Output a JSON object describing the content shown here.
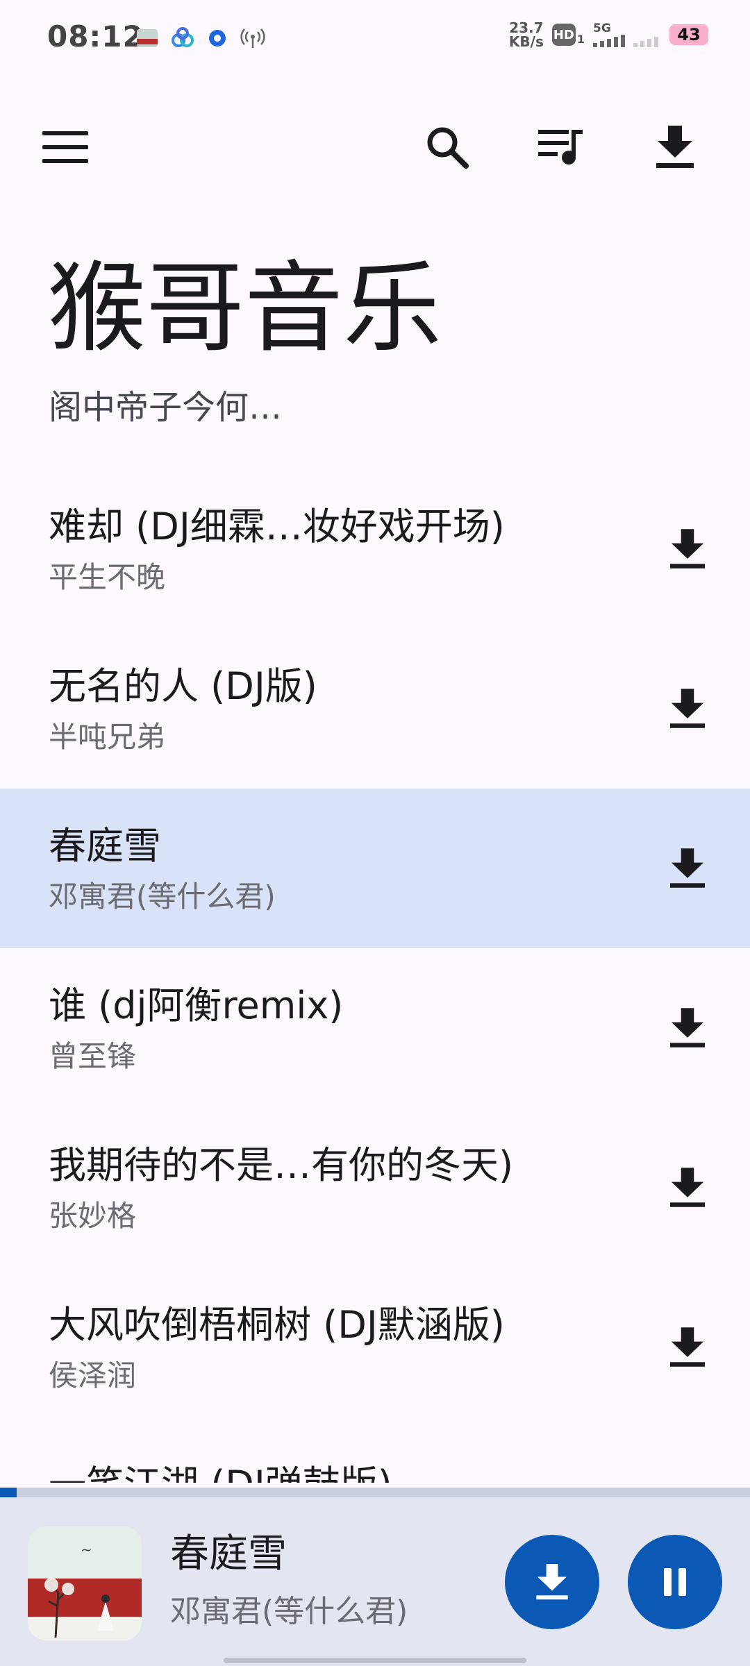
{
  "status_bar": {
    "time": "08:12",
    "net_speed_value": "23.7",
    "net_speed_unit": "KB/s",
    "hd_label": "HD",
    "hd_sub": "1",
    "network_type": "5G",
    "battery": "43"
  },
  "app_bar": {
    "menu_icon": "menu-icon",
    "search_icon": "search-icon",
    "queue_icon": "queue-music-icon",
    "download_icon": "download-icon"
  },
  "header": {
    "title": "猴哥音乐",
    "subtitle": "阁中帝子今何…"
  },
  "songs": [
    {
      "title": "难却 (DJ细霖…妆好戏开场)",
      "artist": "平生不晚",
      "active": false
    },
    {
      "title": "无名的人 (DJ版)",
      "artist": "半吨兄弟",
      "active": false
    },
    {
      "title": "春庭雪",
      "artist": "邓寓君(等什么君)",
      "active": true
    },
    {
      "title": "谁 (dj阿衡remix)",
      "artist": "曾至锋",
      "active": false
    },
    {
      "title": "我期待的不是…有你的冬天)",
      "artist": "张妙格",
      "active": false
    },
    {
      "title": "大风吹倒梧桐树 (DJ默涵版)",
      "artist": "侯泽润",
      "active": false
    },
    {
      "title": "一笑江湖 (DJ弹鼓版)",
      "artist": "",
      "active": false
    }
  ],
  "mini_player": {
    "title": "春庭雪",
    "artist": "邓寓君(等什么君)",
    "progress": 0.022
  },
  "colors": {
    "accent": "#0B59B5",
    "active_row": "#D9E2F6",
    "background": "#FDF8FD",
    "mini_player_bg": "#E3E5F1"
  }
}
